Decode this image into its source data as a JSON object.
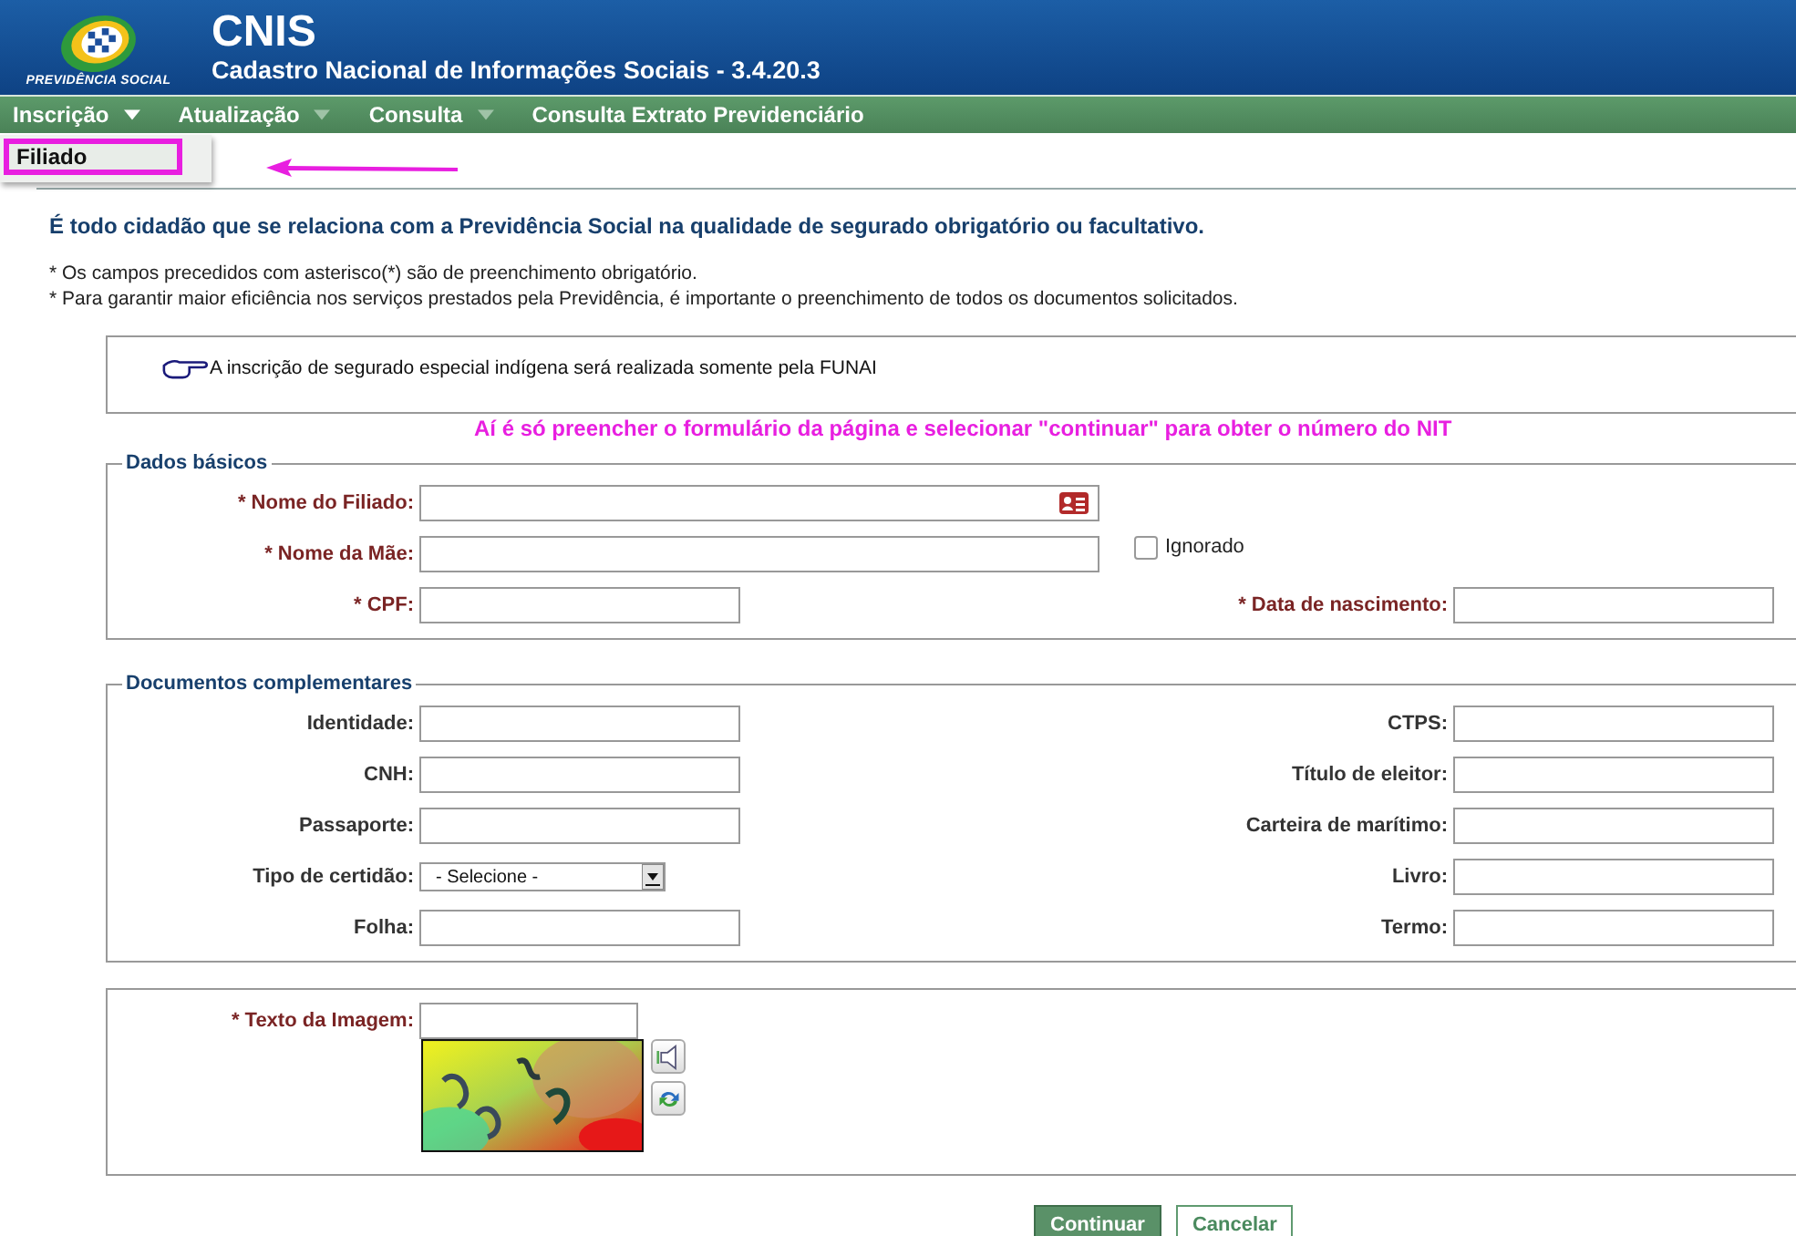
{
  "header": {
    "logo_text": "PREVIDÊNCIA SOCIAL",
    "title": "CNIS",
    "subtitle": "Cadastro Nacional de Informações Sociais - 3.4.20.3"
  },
  "menu": [
    {
      "label": "Inscrição",
      "expanded": true
    },
    {
      "label": "Atualização",
      "expanded": false
    },
    {
      "label": "Consulta",
      "expanded": false
    },
    {
      "label": "Consulta Extrato Previdenciário",
      "has_caret": false,
      "expanded": false
    }
  ],
  "dropdown": {
    "items": [
      {
        "label": "Filiado",
        "annotated": true
      }
    ]
  },
  "intro": "É todo cidadão que se relaciona com a Previdência Social na qualidade de segurado obrigatório ou facultativo.",
  "notes": [
    "* Os campos precedidos com asterisco(*) são de preenchimento obrigatório.",
    "* Para garantir maior eficiência nos serviços prestados pela Previdência, é importante o preenchimento de todos os documentos solicitados."
  ],
  "notice": "A inscrição de segurado especial indígena será realizada somente pela FUNAI",
  "annotation_text": "Aí é só preencher o formulário da página e selecionar \"continuar\" para obter o número do NIT",
  "fieldsets": [
    {
      "legend": "Dados básicos",
      "rows": [
        {
          "kind": "wide",
          "label": "* Nome do Filiado:",
          "required": true,
          "card_icon": true
        },
        {
          "kind": "wide",
          "label": "* Nome da Mãe:",
          "required": true,
          "checkbox": {
            "label": "Ignorado",
            "checked": false
          }
        },
        {
          "kind": "pair",
          "left": {
            "label": "* CPF:",
            "required": true
          },
          "right": {
            "label": "* Data de nascimento:",
            "required": true
          }
        }
      ]
    },
    {
      "legend": "Documentos complementares",
      "rows": [
        {
          "kind": "pair",
          "left": {
            "label": "Identidade:",
            "required": false
          },
          "right": {
            "label": "CTPS:",
            "required": false
          }
        },
        {
          "kind": "pair",
          "left": {
            "label": "CNH:",
            "required": false
          },
          "right": {
            "label": "Título de eleitor:",
            "required": false
          }
        },
        {
          "kind": "pair",
          "left": {
            "label": "Passaporte:",
            "required": false
          },
          "right": {
            "label": "Carteira de marítimo:",
            "required": false
          }
        },
        {
          "kind": "pair",
          "left": {
            "label": "Tipo de certidão:",
            "required": false,
            "select": "- Selecione -"
          },
          "right": {
            "label": "Livro:",
            "required": false
          }
        },
        {
          "kind": "pair",
          "left": {
            "label": "Folha:",
            "required": false
          },
          "right": {
            "label": "Termo:",
            "required": false
          }
        }
      ]
    }
  ],
  "captcha": {
    "label": "* Texto da Imagem:",
    "required": true
  },
  "buttons": [
    {
      "label": "Continuar",
      "primary": true
    },
    {
      "label": "Cancelar",
      "primary": false
    }
  ]
}
